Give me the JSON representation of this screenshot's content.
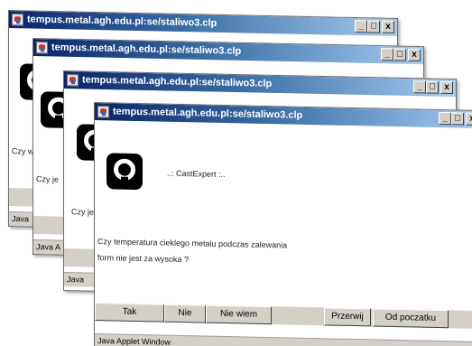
{
  "window": {
    "title": "tempus.metal.agh.edu.pl:se/staliwo3.clp",
    "minimize_label": "_",
    "maximize_label": "□",
    "close_label": "x"
  },
  "app": {
    "name": "..: CastExpert :..",
    "question_line1": "Czy temperatura cieklego metalu podczas zalewania",
    "question_line2": "form nie jest za wysoka ?",
    "status": "Java Applet Window"
  },
  "back_windows": {
    "w1_text": "Czy w",
    "w1_status": "Java",
    "w2_text": "Czy je",
    "w2_status": "Java A",
    "w3_text": "Czy je",
    "w3_status": "Java"
  },
  "buttons": {
    "yes": "Tak",
    "no": "Nie",
    "dont_know": "Nie wiem",
    "abort": "Przerwij",
    "restart": "Od poczatku"
  }
}
